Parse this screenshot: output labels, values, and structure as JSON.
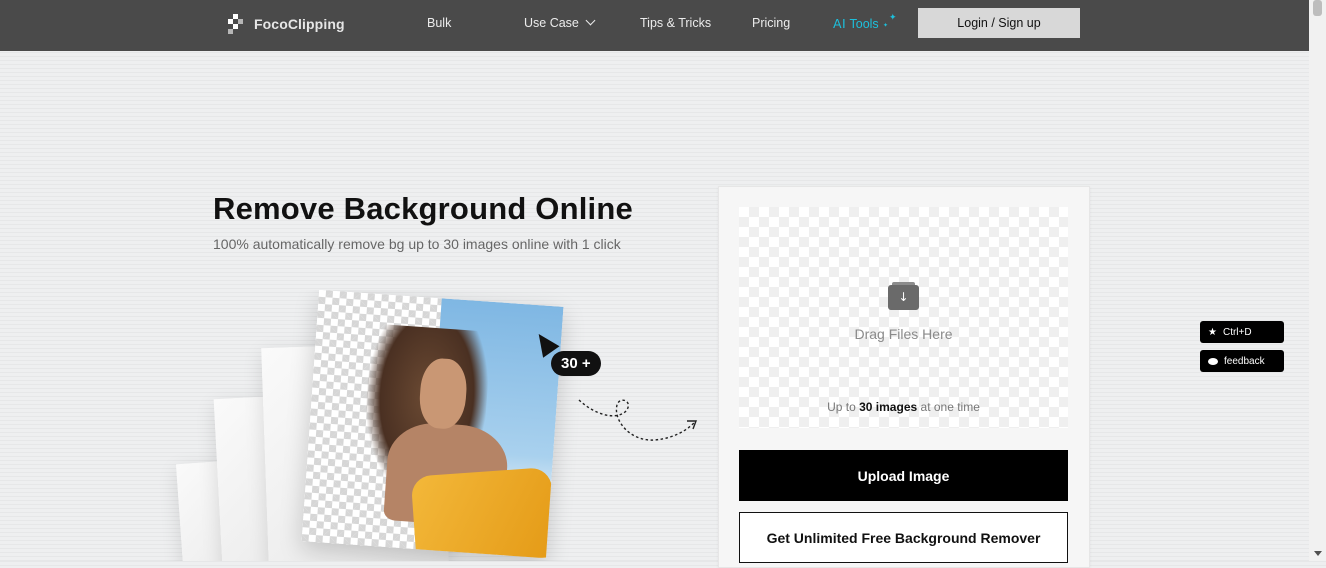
{
  "header": {
    "logo_text": "FocoClipping",
    "nav": [
      {
        "label": "Bulk"
      },
      {
        "label": "Use Case"
      },
      {
        "label": "Tips & Tricks"
      },
      {
        "label": "Pricing"
      }
    ],
    "ai_tools_label": "Tools",
    "ai_prefix": "AI",
    "login_label": "Login / Sign up"
  },
  "hero": {
    "title": "Remove Background Online",
    "subtitle": "100% automatically remove bg up to 30 images online with 1 click",
    "badge": "30 +"
  },
  "upload": {
    "drag_text": "Drag Files Here",
    "limit_prefix": "Up to",
    "limit_bold": "30 images",
    "limit_suffix": "at one time",
    "upload_button": "Upload Image",
    "unlimited_button": "Get Unlimited Free Background Remover"
  },
  "side": {
    "bookmark_label": "Ctrl+D",
    "feedback_label": "feedback"
  },
  "colors": {
    "header_bg": "#4a4a4a",
    "ai_accent": "#1dc0dc",
    "primary_button": "#000000"
  }
}
